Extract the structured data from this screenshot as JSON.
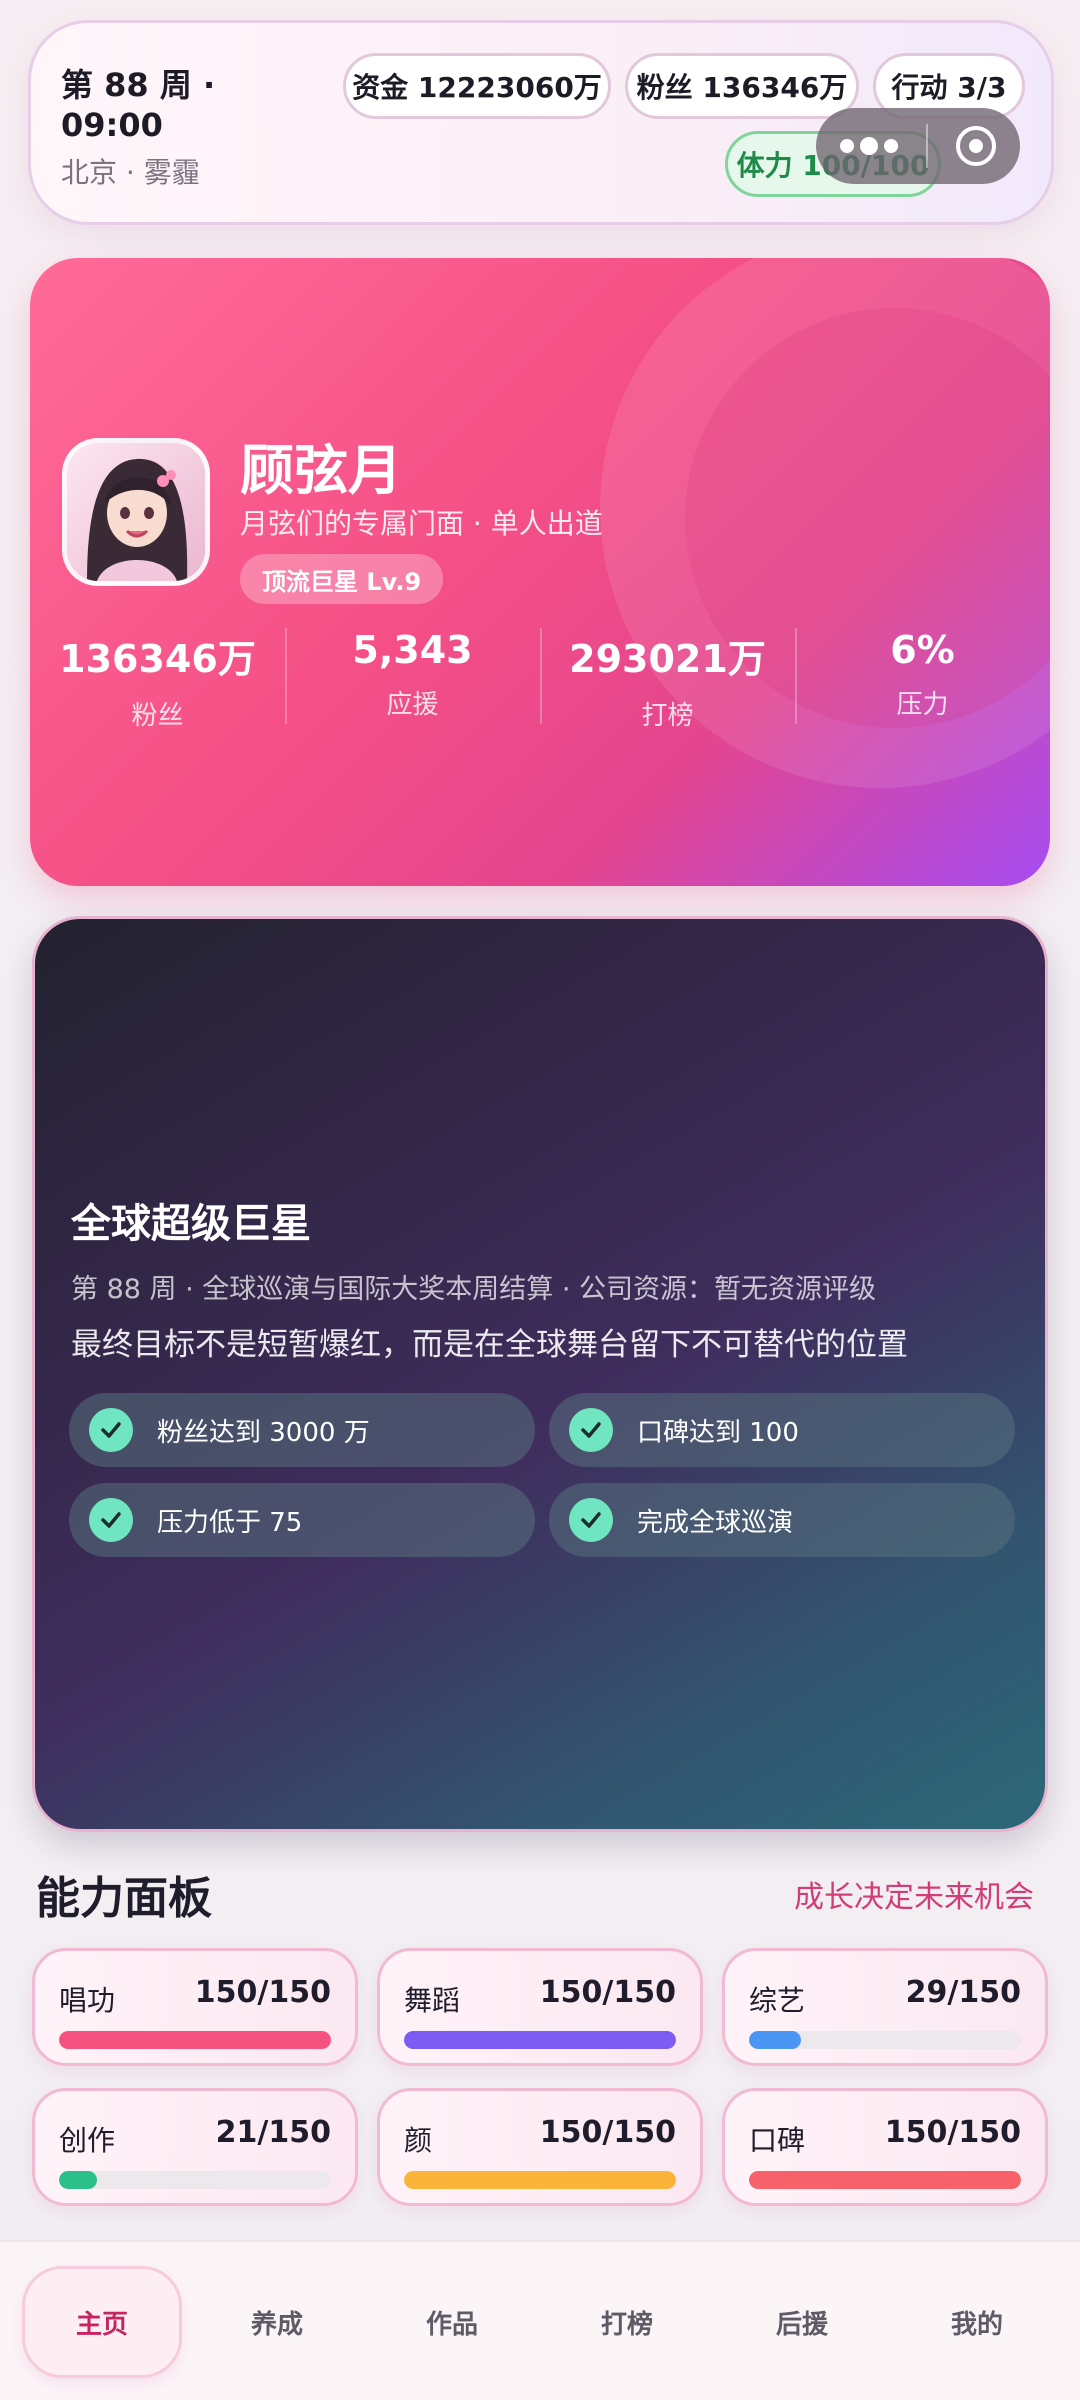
{
  "status": {
    "week_time": "第 88 周 · 09:00",
    "location": "北京 · 雾霾",
    "money": "资金 12223060万",
    "fans": "粉丝 136346万",
    "actions": "行动 3/3",
    "stamina": "体力 100/100"
  },
  "profile": {
    "name": "顾弦月",
    "tagline": "月弦们的专属门面 · 单人出道",
    "level": "顶流巨星 Lv.9",
    "stats": [
      {
        "value": "136346万",
        "label": "粉丝"
      },
      {
        "value": "5,343",
        "label": "应援"
      },
      {
        "value": "293021万",
        "label": "打榜"
      },
      {
        "value": "6%",
        "label": "压力"
      }
    ]
  },
  "goal": {
    "title": "全球超级巨星",
    "subtitle": "第 88 周 · 全球巡演与国际大奖本周结算 · 公司资源：暂无资源评级",
    "description": "最终目标不是短暂爆红，而是在全球舞台留下不可替代的位置",
    "tasks": [
      {
        "label": "粉丝达到 3000 万",
        "done": true
      },
      {
        "label": "口碑达到 100",
        "done": true
      },
      {
        "label": "压力低于 75",
        "done": true
      },
      {
        "label": "完成全球巡演",
        "done": true
      }
    ]
  },
  "abilities": {
    "title": "能力面板",
    "hint": "成长决定未来机会",
    "items": [
      {
        "name": "唱功",
        "value": "150/150",
        "ratio": 1.0,
        "color": "#f5527f"
      },
      {
        "name": "舞蹈",
        "value": "150/150",
        "ratio": 1.0,
        "color": "#7d5cf3"
      },
      {
        "name": "综艺",
        "value": "29/150",
        "ratio": 0.193,
        "color": "#4a96f2"
      },
      {
        "name": "创作",
        "value": "21/150",
        "ratio": 0.14,
        "color": "#2bc08a"
      },
      {
        "name": "颜",
        "value": "150/150",
        "ratio": 1.0,
        "color": "#fbb43a"
      },
      {
        "name": "口碑",
        "value": "150/150",
        "ratio": 1.0,
        "color": "#f7626a"
      }
    ]
  },
  "nav": {
    "items": [
      "主页",
      "养成",
      "作品",
      "打榜",
      "后援",
      "我的"
    ],
    "active": "主页"
  }
}
